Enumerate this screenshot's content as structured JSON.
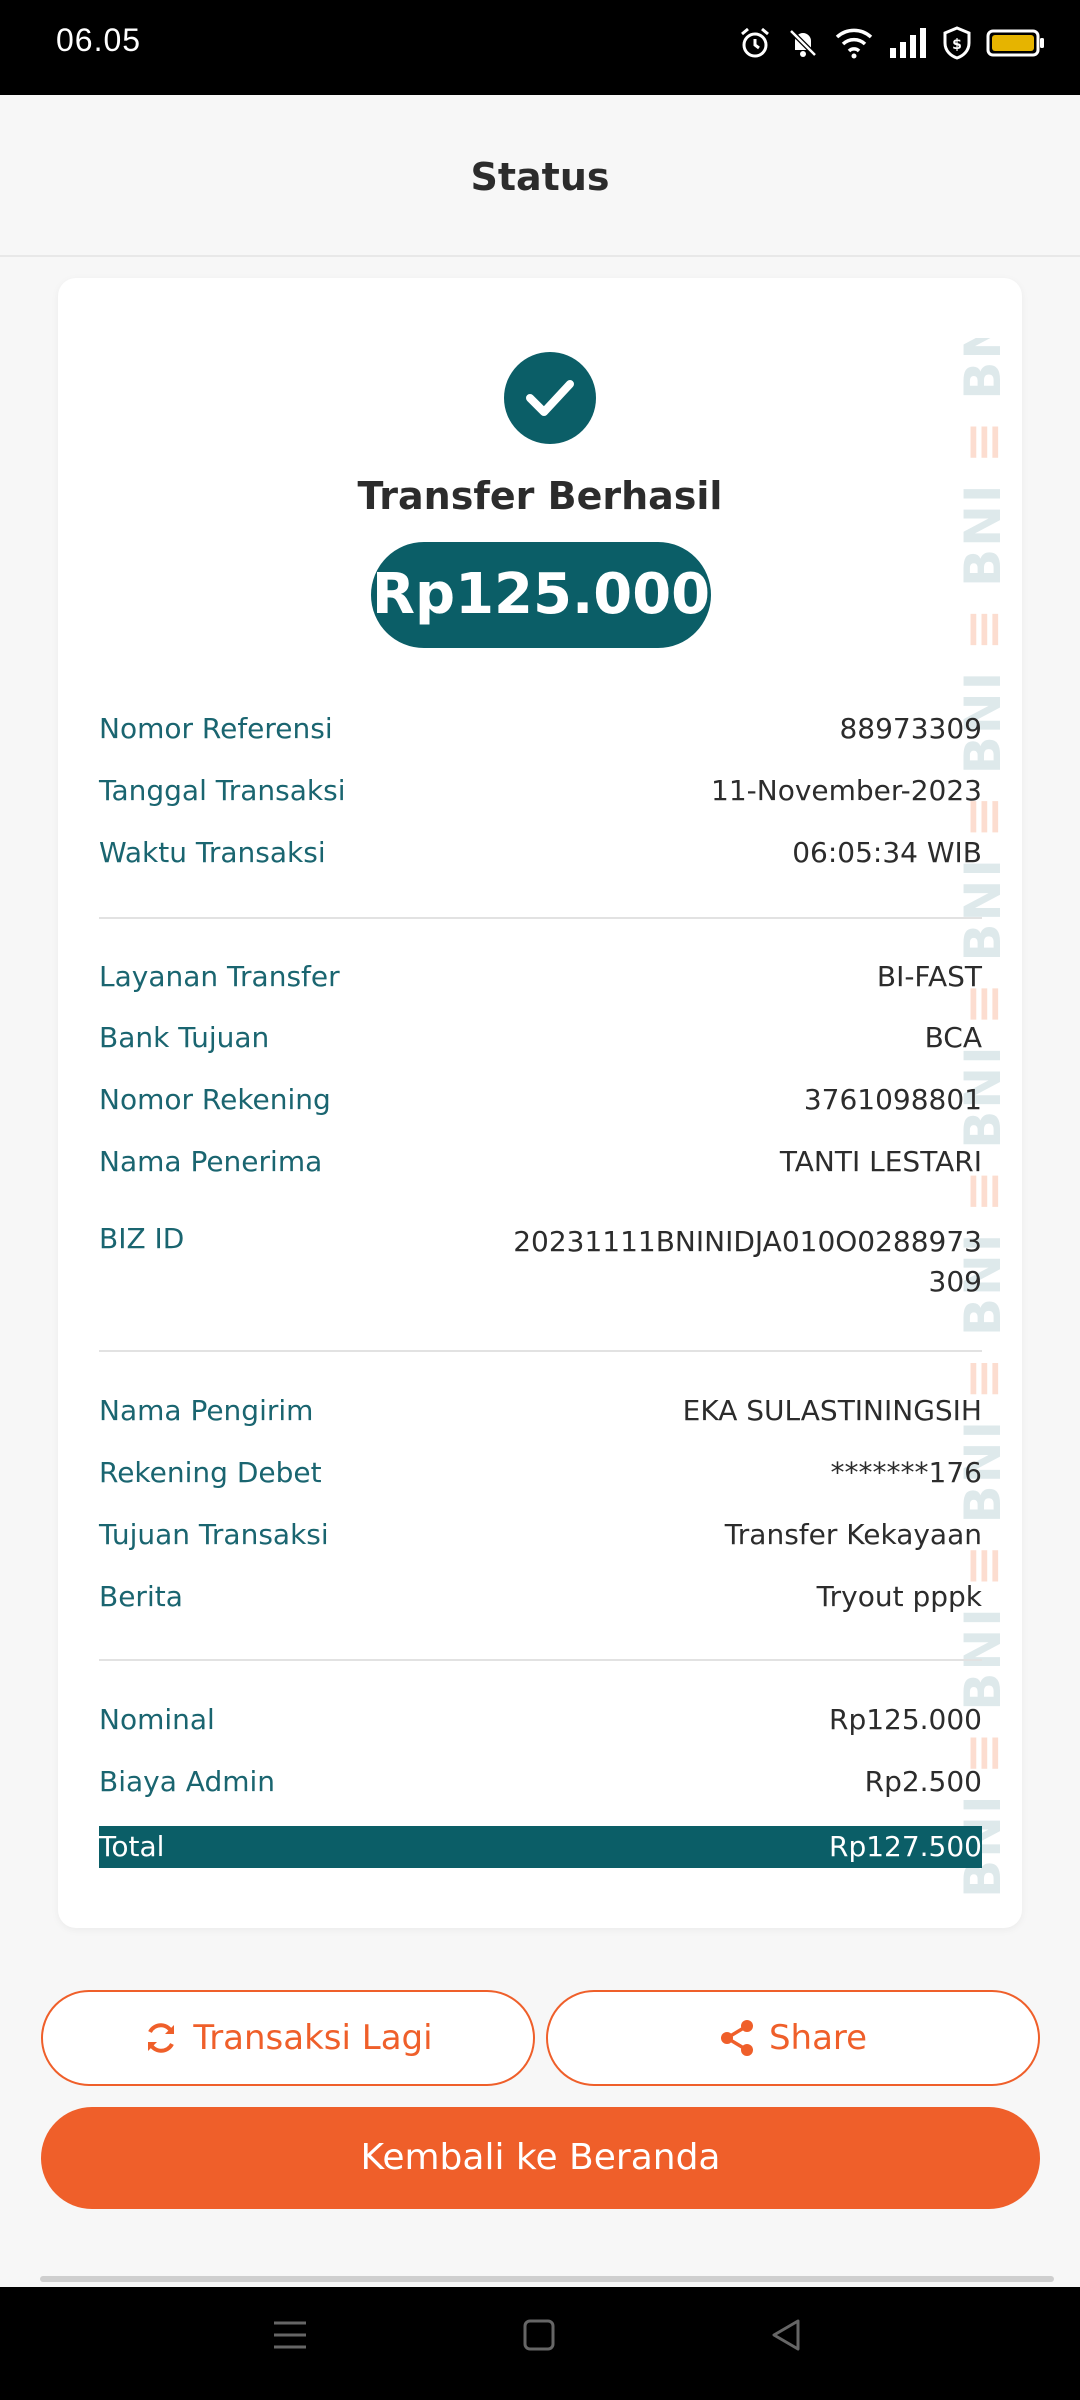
{
  "status_bar": {
    "time": "06.05",
    "icons": [
      "alarm-icon",
      "mute-icon",
      "wifi-icon",
      "signal-icon",
      "vpn-icon",
      "battery-icon"
    ]
  },
  "header": {
    "title": "Status"
  },
  "receipt": {
    "status_text": "Transfer Berhasil",
    "amount": "Rp125.000",
    "watermark": "BNI",
    "section1": [
      {
        "label": "Nomor Referensi",
        "value": "88973309"
      },
      {
        "label": "Tanggal Transaksi",
        "value": "11-November-2023"
      },
      {
        "label": "Waktu Transaksi",
        "value": "06:05:34 WIB"
      }
    ],
    "section2": [
      {
        "label": "Layanan Transfer",
        "value": "BI-FAST"
      },
      {
        "label": "Bank Tujuan",
        "value": "BCA"
      },
      {
        "label": "Nomor Rekening",
        "value": "3761098801"
      },
      {
        "label": "Nama Penerima",
        "value": "TANTI LESTARI"
      },
      {
        "label": "BIZ ID",
        "value": "20231111BNINIDJA010O0288973309"
      }
    ],
    "section3": [
      {
        "label": "Nama Pengirim",
        "value": "EKA SULASTININGSIH"
      },
      {
        "label": "Rekening Debet",
        "value": "*******176"
      },
      {
        "label": "Tujuan Transaksi",
        "value": "Transfer Kekayaan"
      },
      {
        "label": "Berita",
        "value": "Tryout pppk"
      }
    ],
    "section4": [
      {
        "label": "Nominal",
        "value": "Rp125.000"
      },
      {
        "label": "Biaya Admin",
        "value": "Rp2.500"
      }
    ],
    "total": {
      "label": "Total",
      "value": "Rp127.500"
    }
  },
  "buttons": {
    "again": "Transaksi Lagi",
    "share": "Share",
    "home": "Kembali ke Beranda"
  },
  "colors": {
    "primary_teal": "#0b5e67",
    "accent_orange": "#ef5f2a",
    "label_teal": "#1a6570"
  }
}
